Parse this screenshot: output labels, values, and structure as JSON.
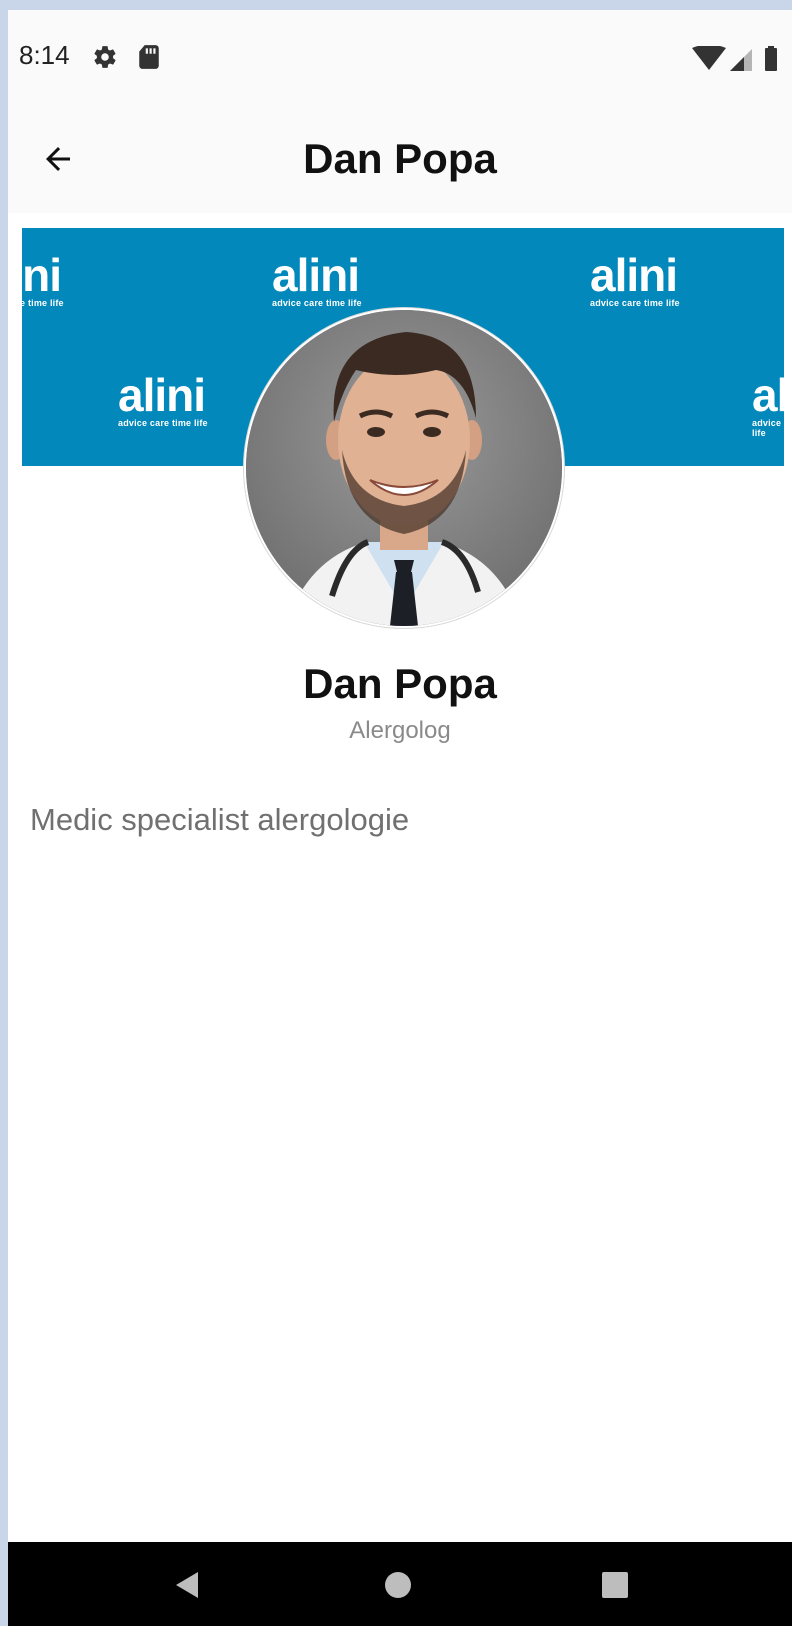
{
  "status_bar": {
    "time": "8:14",
    "icons": [
      "gear-icon",
      "sd-card-icon",
      "wifi-icon",
      "cell-signal-icon",
      "battery-icon"
    ]
  },
  "app_bar": {
    "title": "Dan Popa",
    "back_icon": "arrow-left-icon"
  },
  "cover": {
    "brand_word": "alini",
    "brand_tagline": "advice care time life",
    "background_color": "#0288ba"
  },
  "profile": {
    "name": "Dan Popa",
    "role": "Alergolog",
    "description": "Medic specialist alergologie"
  },
  "nav_bar": {
    "icons": [
      "nav-back-icon",
      "nav-home-icon",
      "nav-recents-icon"
    ]
  }
}
